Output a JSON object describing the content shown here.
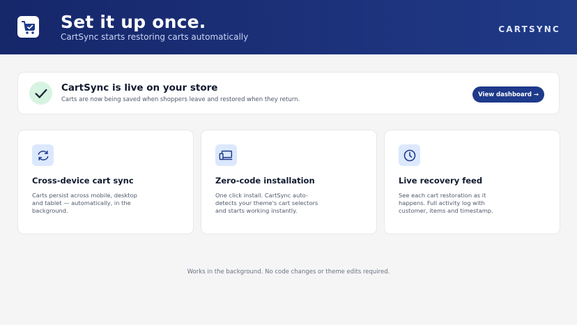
{
  "hero": {
    "title": "Set it up once.",
    "subtitle": "CartSync starts restoring carts automatically",
    "brand": "CARTSYNC",
    "logo_icon": "shopping-cart-icon"
  },
  "status": {
    "icon": "checkmark-icon",
    "title": "CartSync is live on your store",
    "subtitle": "Carts are now being saved when shoppers leave and restored when they return.",
    "button_label": "View dashboard →"
  },
  "features": [
    {
      "icon": "sync-arrows-icon",
      "title": "Cross-device cart sync",
      "description": "Carts persist across mobile, desktop and tablet — automatically, in the background."
    },
    {
      "icon": "devices-icon",
      "title": "Zero-code installation",
      "description": "One click install. CartSync auto-detects your theme's cart selectors and starts working instantly."
    },
    {
      "icon": "clock-icon",
      "title": "Live recovery feed",
      "description": "See each cart restoration as it happens. Full activity log with customer, items and timestamp."
    }
  ],
  "footer": {
    "note": "Works in the background. No code changes or theme edits required."
  },
  "colors": {
    "header": "#1c317a",
    "accent": "#1e3a8a",
    "success_bg": "#d7f3e1",
    "icon_bg": "#dce8fd",
    "page_bg": "#f5f5f6"
  }
}
